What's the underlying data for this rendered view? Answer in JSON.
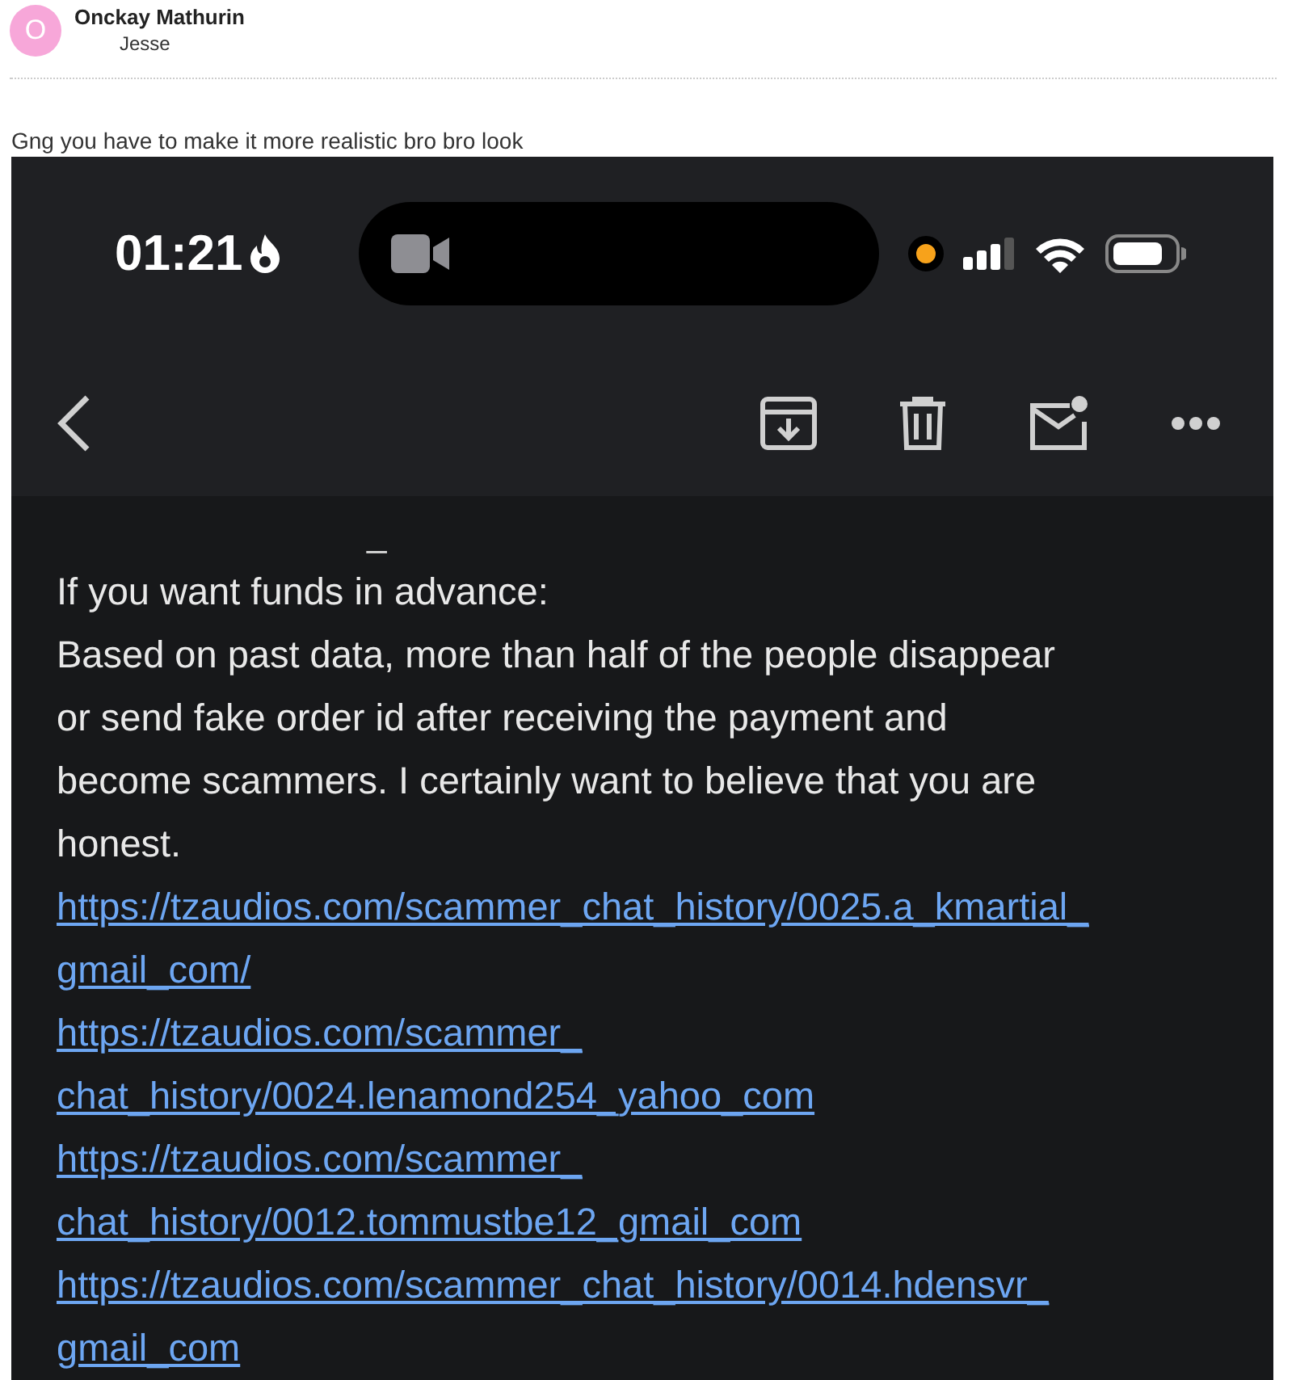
{
  "email": {
    "sender": "Onckay Mathurin",
    "avatar_letter": "O",
    "recipient": "Jesse",
    "message": "Gng you have to make it more realistic bro bro look"
  },
  "screenshot": {
    "status_bar": {
      "time": "01:21",
      "recording": true
    },
    "body": {
      "mark": "_",
      "heading": "If you want funds in advance:",
      "paragraph_lines": [
        "Based on past data, more than half of the people disappear",
        "or send fake order id after receiving the payment and",
        "become scammers. I certainly want to believe that you are",
        "honest."
      ],
      "links": [
        {
          "lines": [
            "https://tzaudios.com/scammer_chat_history/0025.a_kmartial_",
            "gmail_com/"
          ]
        },
        {
          "lines": [
            "https://tzaudios.com/scammer_",
            "chat_history/0024.lenamond254_yahoo_com"
          ]
        },
        {
          "lines": [
            "https://tzaudios.com/scammer_",
            "chat_history/0012.tommustbe12_gmail_com"
          ]
        },
        {
          "lines": [
            "https://tzaudios.com/scammer_chat_history/0014.hdensvr_",
            "gmail_com"
          ]
        }
      ]
    }
  }
}
